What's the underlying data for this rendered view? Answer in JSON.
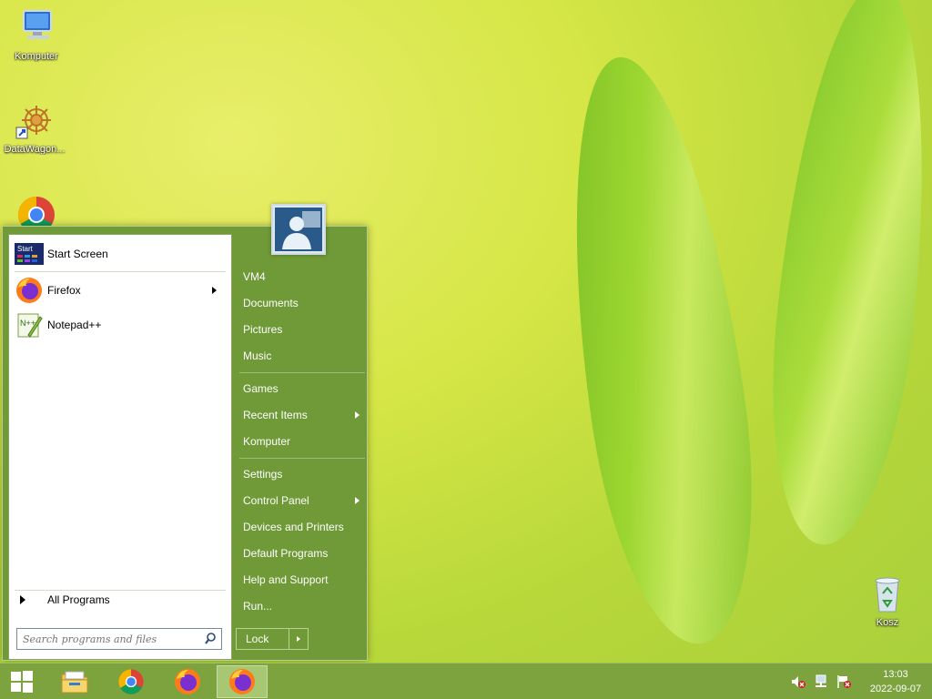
{
  "desktop": {
    "icons": [
      {
        "label": "Komputer"
      },
      {
        "label": "DataWagon..."
      },
      {
        "label": ""
      },
      {
        "label": "Kosz"
      }
    ]
  },
  "start_menu": {
    "pinned": [
      {
        "label": "Start Screen"
      },
      {
        "label": "Firefox"
      },
      {
        "label": "Notepad++"
      }
    ],
    "all_programs": "All Programs",
    "search_placeholder": "Search programs and files",
    "right_items": [
      {
        "label": "VM4"
      },
      {
        "label": "Documents"
      },
      {
        "label": "Pictures"
      },
      {
        "label": "Music"
      },
      {
        "label": "Games"
      },
      {
        "label": "Recent Items"
      },
      {
        "label": "Komputer"
      },
      {
        "label": "Settings"
      },
      {
        "label": "Control Panel"
      },
      {
        "label": "Devices and Printers"
      },
      {
        "label": "Default Programs"
      },
      {
        "label": "Help and Support"
      },
      {
        "label": "Run..."
      }
    ],
    "lock_label": "Lock",
    "start_screen_tile_text": "Start"
  },
  "taskbar": {
    "items": [
      "windows-start-icon",
      "file-explorer-icon",
      "chrome-icon",
      "firefox-icon",
      "firefox-icon"
    ],
    "clock_time": "13:03",
    "clock_date": "2022-09-07"
  },
  "colors": {
    "menu_green": "#6f9a37",
    "taskbar_green": "#7da33e"
  }
}
